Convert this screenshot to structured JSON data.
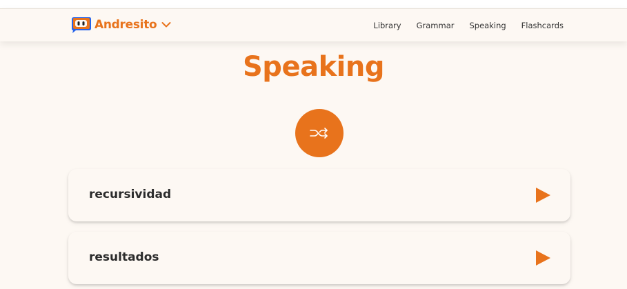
{
  "brand": {
    "name": "Andresito",
    "color": "#e8731c",
    "logo_icon": "robot-face-icon",
    "dropdown_icon": "chevron-down-icon"
  },
  "nav": {
    "links": [
      {
        "label": "Library"
      },
      {
        "label": "Grammar"
      },
      {
        "label": "Speaking"
      },
      {
        "label": "Flashcards"
      }
    ]
  },
  "page": {
    "title": "Speaking",
    "accent_color": "#e8731c",
    "background_color": "#fdf8f3"
  },
  "shuffle": {
    "icon": "shuffle-icon"
  },
  "cards": [
    {
      "word": "recursividad",
      "action_icon": "play-icon"
    },
    {
      "word": "resultados",
      "action_icon": "play-icon"
    }
  ]
}
